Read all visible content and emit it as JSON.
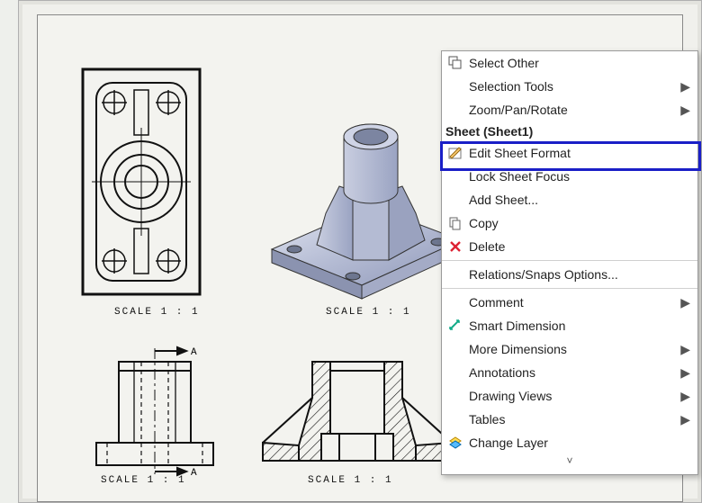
{
  "scale_labels": {
    "view1": "SCALE 1 : 1",
    "view2": "SCALE 1 : 1",
    "view3": "SCALE 1 : 1",
    "view4": "SCALE 1 : 1"
  },
  "section_marker": "A",
  "context_menu": {
    "header": "Sheet (Sheet1)",
    "items": {
      "select_other": "Select Other",
      "selection_tools": "Selection Tools",
      "zoom_pan_rotate": "Zoom/Pan/Rotate",
      "edit_sheet_format": "Edit Sheet Format",
      "lock_sheet_focus": "Lock Sheet Focus",
      "add_sheet": "Add Sheet...",
      "copy": "Copy",
      "delete": "Delete",
      "relations_snaps": "Relations/Snaps Options...",
      "comment": "Comment",
      "smart_dimension": "Smart Dimension",
      "more_dimensions": "More Dimensions",
      "annotations": "Annotations",
      "drawing_views": "Drawing Views",
      "tables": "Tables",
      "change_layer": "Change Layer"
    }
  }
}
